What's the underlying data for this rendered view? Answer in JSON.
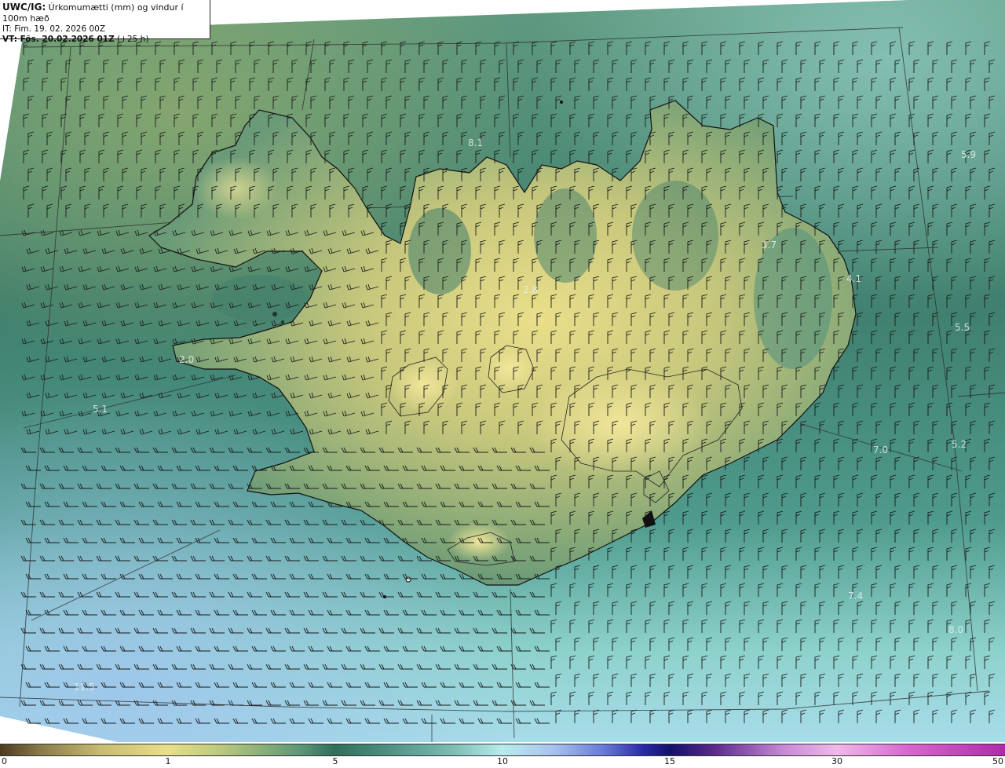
{
  "header": {
    "title_code": "UWC/IG:",
    "title_text": "Úrkomumætti (mm) og vindur í 100m hæð",
    "init_time": "IT: Fim. 19. 02. 2026 00Z",
    "valid_time": "VT: Fös. 20.02.2026 01Z",
    "lead_time": "(+25 h)"
  },
  "map_values": [
    {
      "id": "nw-coast",
      "text": "8.1"
    },
    {
      "id": "far-east-upper",
      "text": "5.9"
    },
    {
      "id": "northeast",
      "text": "3.7"
    },
    {
      "id": "north-central",
      "text": "2.8"
    },
    {
      "id": "east-coast",
      "text": "4.1"
    },
    {
      "id": "east-sea-upper",
      "text": "5.5"
    },
    {
      "id": "snaefellsnes",
      "text": "2.0"
    },
    {
      "id": "west-sea",
      "text": "5.1"
    },
    {
      "id": "east-sea-lower",
      "text": "7.0"
    },
    {
      "id": "far-east-lower",
      "text": "5.2"
    },
    {
      "id": "southeast-sea",
      "text": "7.4"
    },
    {
      "id": "south-east-sea",
      "text": "8.0"
    },
    {
      "id": "southwest-sea",
      "text": "11.5"
    }
  ],
  "colorbar": {
    "unit": "mm",
    "ticks": [
      "0",
      "1",
      "5",
      "10",
      "15",
      "30",
      "50"
    ],
    "colors": {
      "dry": "#4a3a22",
      "one": "#e8df8a",
      "five": "#2f6e5a",
      "ten": "#b8ecec",
      "fifteen": "#12126a",
      "thirty": "#f0b8e8",
      "fifty": "#b02aa8"
    }
  },
  "wind": {
    "direction": "southerly to south-westerly",
    "barb_color": "#1a1a1a"
  }
}
